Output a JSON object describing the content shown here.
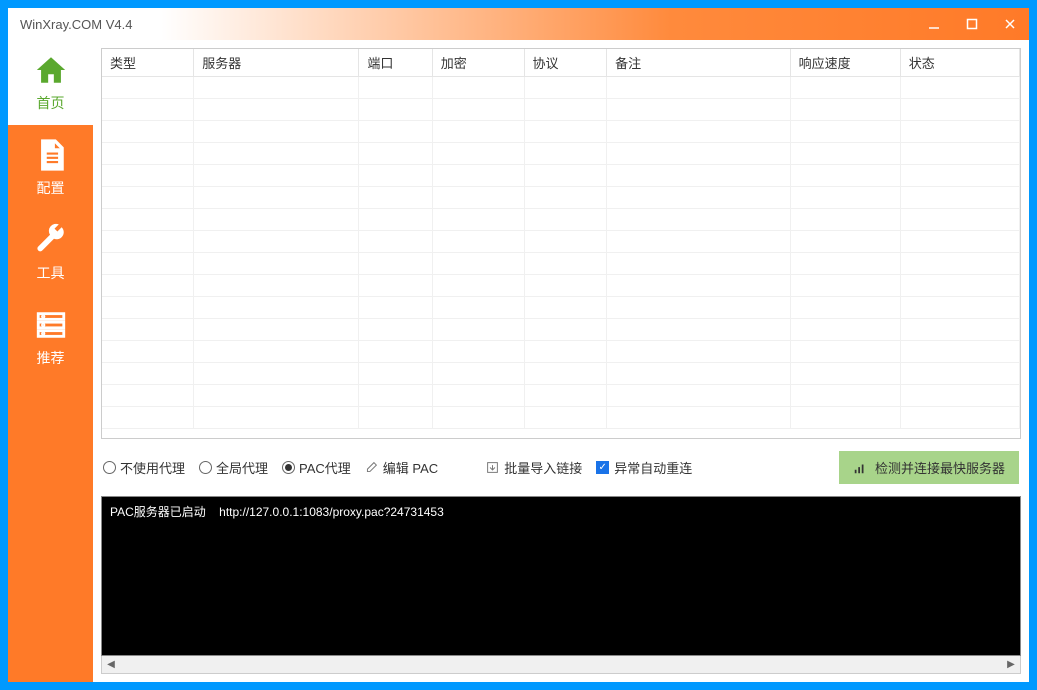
{
  "title": "WinXray.COM    V4.4",
  "sidebar": {
    "items": [
      {
        "label": "首页",
        "icon": "home"
      },
      {
        "label": "配置",
        "icon": "document"
      },
      {
        "label": "工具",
        "icon": "wrench"
      },
      {
        "label": "推荐",
        "icon": "server"
      }
    ]
  },
  "table": {
    "columns": [
      "类型",
      "服务器",
      "端口",
      "加密",
      "协议",
      "备注",
      "响应速度",
      "状态"
    ]
  },
  "controls": {
    "radio_no_proxy": "不使用代理",
    "radio_global": "全局代理",
    "radio_pac": "PAC代理",
    "edit_pac": "编辑 PAC",
    "bulk_import": "批量导入链接",
    "auto_reconnect": "异常自动重连",
    "detect_button": "检测并连接最快服务器"
  },
  "console": {
    "line1_label": "PAC服务器已启动",
    "line1_url": "http://127.0.0.1:1083/proxy.pac?24731453"
  }
}
